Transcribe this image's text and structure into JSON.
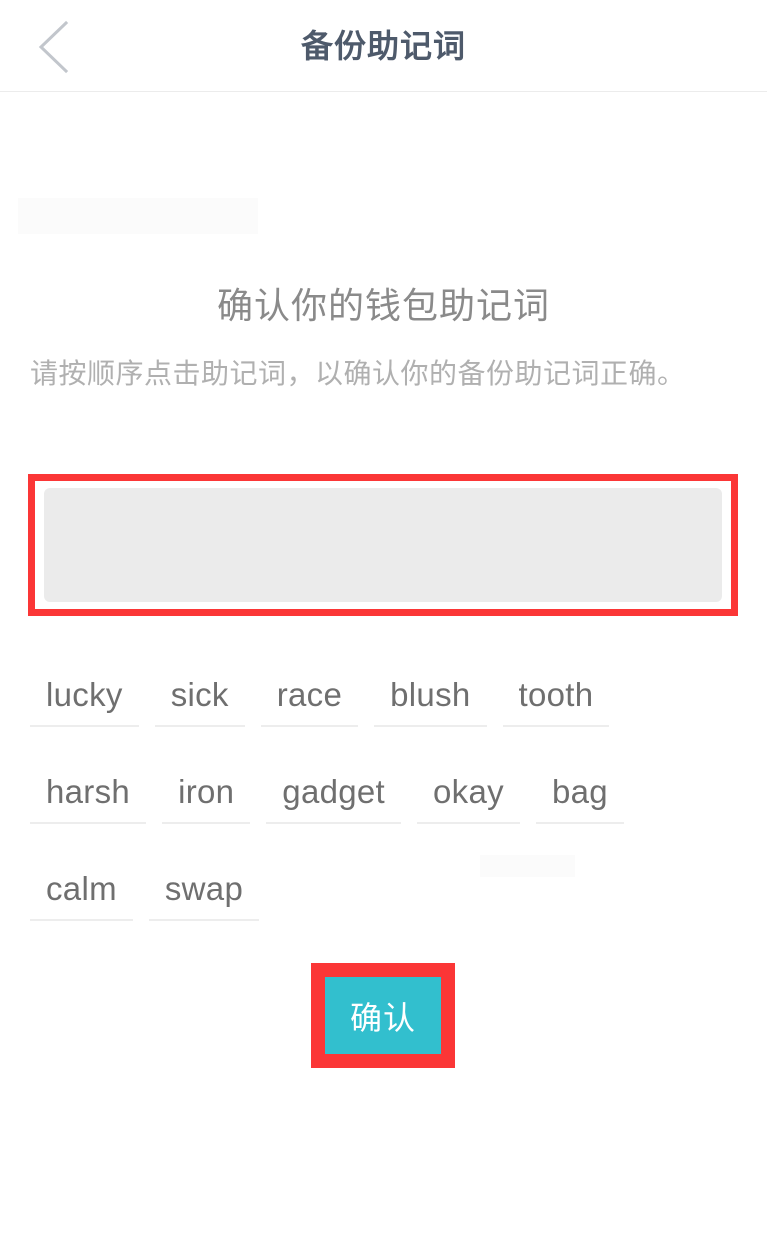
{
  "header": {
    "back_icon": "chevron-left-icon",
    "title": "备份助记词"
  },
  "main": {
    "page_title": "确认你的钱包助记词",
    "description": "请按顺序点击助记词，以确认你的备份助记词正确。",
    "selected_words": [],
    "selected_box_placeholder": "",
    "word_bank": [
      "lucky",
      "sick",
      "race",
      "blush",
      "tooth",
      "harsh",
      "iron",
      "gadget",
      "okay",
      "bag",
      "calm",
      "swap"
    ],
    "confirm_label": "确认"
  },
  "colors": {
    "header_title": "#4e5a6b",
    "page_title": "#8a8a8a",
    "description": "#b0b0b0",
    "word_text": "#6f6f6f",
    "word_underline": "#ededed",
    "input_box_bg": "#ebebeb",
    "highlight_border": "#fb3636",
    "confirm_bg": "#32bfce",
    "confirm_text": "#ffffff",
    "page_bg": "#ffffff"
  }
}
